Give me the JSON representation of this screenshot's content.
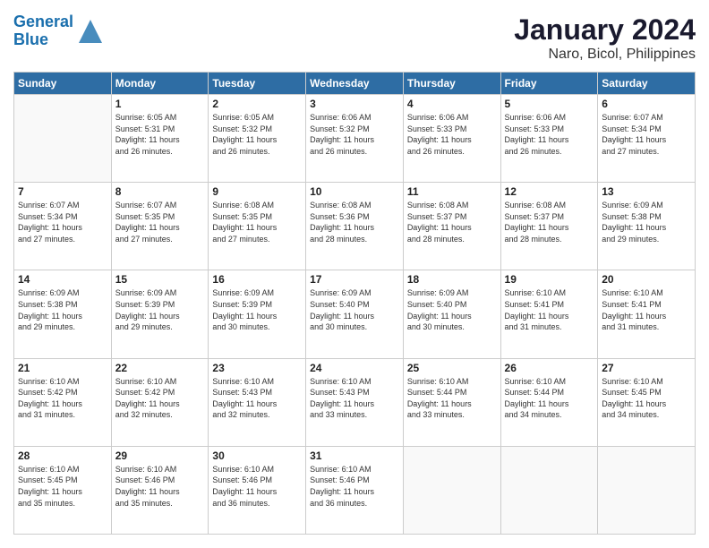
{
  "header": {
    "logo_line1": "General",
    "logo_line2": "Blue",
    "title": "January 2024",
    "subtitle": "Naro, Bicol, Philippines"
  },
  "weekdays": [
    "Sunday",
    "Monday",
    "Tuesday",
    "Wednesday",
    "Thursday",
    "Friday",
    "Saturday"
  ],
  "weeks": [
    [
      {
        "day": "",
        "info": ""
      },
      {
        "day": "1",
        "info": "Sunrise: 6:05 AM\nSunset: 5:31 PM\nDaylight: 11 hours\nand 26 minutes."
      },
      {
        "day": "2",
        "info": "Sunrise: 6:05 AM\nSunset: 5:32 PM\nDaylight: 11 hours\nand 26 minutes."
      },
      {
        "day": "3",
        "info": "Sunrise: 6:06 AM\nSunset: 5:32 PM\nDaylight: 11 hours\nand 26 minutes."
      },
      {
        "day": "4",
        "info": "Sunrise: 6:06 AM\nSunset: 5:33 PM\nDaylight: 11 hours\nand 26 minutes."
      },
      {
        "day": "5",
        "info": "Sunrise: 6:06 AM\nSunset: 5:33 PM\nDaylight: 11 hours\nand 26 minutes."
      },
      {
        "day": "6",
        "info": "Sunrise: 6:07 AM\nSunset: 5:34 PM\nDaylight: 11 hours\nand 27 minutes."
      }
    ],
    [
      {
        "day": "7",
        "info": "Sunrise: 6:07 AM\nSunset: 5:34 PM\nDaylight: 11 hours\nand 27 minutes."
      },
      {
        "day": "8",
        "info": "Sunrise: 6:07 AM\nSunset: 5:35 PM\nDaylight: 11 hours\nand 27 minutes."
      },
      {
        "day": "9",
        "info": "Sunrise: 6:08 AM\nSunset: 5:35 PM\nDaylight: 11 hours\nand 27 minutes."
      },
      {
        "day": "10",
        "info": "Sunrise: 6:08 AM\nSunset: 5:36 PM\nDaylight: 11 hours\nand 28 minutes."
      },
      {
        "day": "11",
        "info": "Sunrise: 6:08 AM\nSunset: 5:37 PM\nDaylight: 11 hours\nand 28 minutes."
      },
      {
        "day": "12",
        "info": "Sunrise: 6:08 AM\nSunset: 5:37 PM\nDaylight: 11 hours\nand 28 minutes."
      },
      {
        "day": "13",
        "info": "Sunrise: 6:09 AM\nSunset: 5:38 PM\nDaylight: 11 hours\nand 29 minutes."
      }
    ],
    [
      {
        "day": "14",
        "info": "Sunrise: 6:09 AM\nSunset: 5:38 PM\nDaylight: 11 hours\nand 29 minutes."
      },
      {
        "day": "15",
        "info": "Sunrise: 6:09 AM\nSunset: 5:39 PM\nDaylight: 11 hours\nand 29 minutes."
      },
      {
        "day": "16",
        "info": "Sunrise: 6:09 AM\nSunset: 5:39 PM\nDaylight: 11 hours\nand 30 minutes."
      },
      {
        "day": "17",
        "info": "Sunrise: 6:09 AM\nSunset: 5:40 PM\nDaylight: 11 hours\nand 30 minutes."
      },
      {
        "day": "18",
        "info": "Sunrise: 6:09 AM\nSunset: 5:40 PM\nDaylight: 11 hours\nand 30 minutes."
      },
      {
        "day": "19",
        "info": "Sunrise: 6:10 AM\nSunset: 5:41 PM\nDaylight: 11 hours\nand 31 minutes."
      },
      {
        "day": "20",
        "info": "Sunrise: 6:10 AM\nSunset: 5:41 PM\nDaylight: 11 hours\nand 31 minutes."
      }
    ],
    [
      {
        "day": "21",
        "info": "Sunrise: 6:10 AM\nSunset: 5:42 PM\nDaylight: 11 hours\nand 31 minutes."
      },
      {
        "day": "22",
        "info": "Sunrise: 6:10 AM\nSunset: 5:42 PM\nDaylight: 11 hours\nand 32 minutes."
      },
      {
        "day": "23",
        "info": "Sunrise: 6:10 AM\nSunset: 5:43 PM\nDaylight: 11 hours\nand 32 minutes."
      },
      {
        "day": "24",
        "info": "Sunrise: 6:10 AM\nSunset: 5:43 PM\nDaylight: 11 hours\nand 33 minutes."
      },
      {
        "day": "25",
        "info": "Sunrise: 6:10 AM\nSunset: 5:44 PM\nDaylight: 11 hours\nand 33 minutes."
      },
      {
        "day": "26",
        "info": "Sunrise: 6:10 AM\nSunset: 5:44 PM\nDaylight: 11 hours\nand 34 minutes."
      },
      {
        "day": "27",
        "info": "Sunrise: 6:10 AM\nSunset: 5:45 PM\nDaylight: 11 hours\nand 34 minutes."
      }
    ],
    [
      {
        "day": "28",
        "info": "Sunrise: 6:10 AM\nSunset: 5:45 PM\nDaylight: 11 hours\nand 35 minutes."
      },
      {
        "day": "29",
        "info": "Sunrise: 6:10 AM\nSunset: 5:46 PM\nDaylight: 11 hours\nand 35 minutes."
      },
      {
        "day": "30",
        "info": "Sunrise: 6:10 AM\nSunset: 5:46 PM\nDaylight: 11 hours\nand 36 minutes."
      },
      {
        "day": "31",
        "info": "Sunrise: 6:10 AM\nSunset: 5:46 PM\nDaylight: 11 hours\nand 36 minutes."
      },
      {
        "day": "",
        "info": ""
      },
      {
        "day": "",
        "info": ""
      },
      {
        "day": "",
        "info": ""
      }
    ]
  ]
}
